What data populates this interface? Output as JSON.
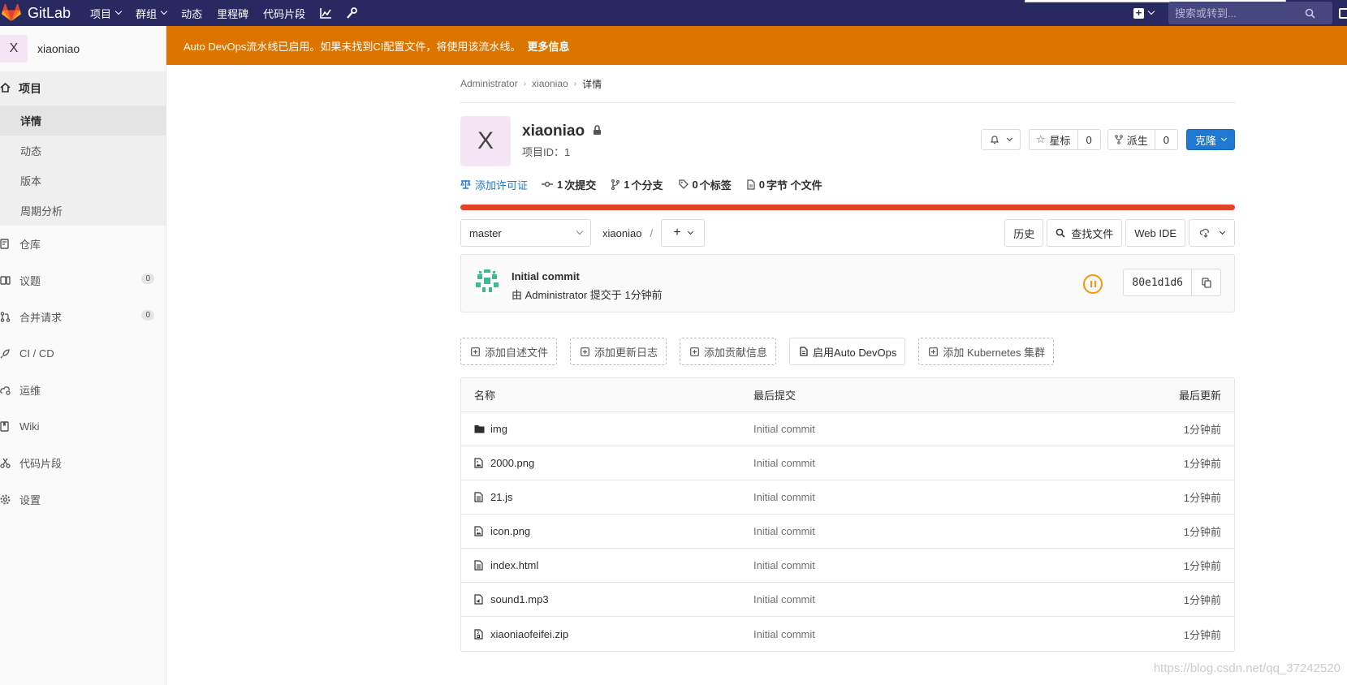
{
  "navbar": {
    "brand": "GitLab",
    "items": [
      {
        "label": "项目",
        "caret": true
      },
      {
        "label": "群组",
        "caret": true
      },
      {
        "label": "动态",
        "caret": false
      },
      {
        "label": "里程碑",
        "caret": false
      },
      {
        "label": "代码片段",
        "caret": false
      }
    ],
    "search_placeholder": "搜索或转到...",
    "colors": {
      "bg": "#292961",
      "logo": "#e24329"
    }
  },
  "sidebar": {
    "project_avatar_letter": "X",
    "project_name": "xiaoniao",
    "section_label": "项目",
    "sub_items": [
      "详情",
      "动态",
      "版本",
      "周期分析"
    ],
    "items": [
      {
        "label": "仓库",
        "icon": "repository-icon"
      },
      {
        "label": "议题",
        "icon": "issues-icon",
        "badge": "0"
      },
      {
        "label": "合并请求",
        "icon": "merge-request-icon",
        "badge": "0"
      },
      {
        "label": "CI / CD",
        "icon": "rocket-icon"
      },
      {
        "label": "运维",
        "icon": "cloud-gear-icon"
      },
      {
        "label": "Wiki",
        "icon": "book-icon"
      },
      {
        "label": "代码片段",
        "icon": "scissors-icon"
      },
      {
        "label": "设置",
        "icon": "gear-icon"
      }
    ]
  },
  "banner": {
    "text": "Auto DevOps流水线已启用。如果未找到CI配置文件，将使用该流水线。",
    "link": "更多信息",
    "color": "#db7500"
  },
  "breadcrumb": [
    "Administrator",
    "xiaoniao",
    "详情"
  ],
  "project": {
    "avatar_letter": "X",
    "name": "xiaoniao",
    "id_label": "项目ID：1",
    "star_label": "星标",
    "star_count": "0",
    "fork_label": "派生",
    "fork_count": "0",
    "clone_label": "克隆"
  },
  "stats": {
    "license": "添加许可证",
    "commits_num": "1",
    "commits_label": "次提交",
    "branches_num": "1",
    "branches_label": "个分支",
    "tags_num": "0",
    "tags_label": "个标签",
    "size_num": "0",
    "size_label": "字节 个文件"
  },
  "repo": {
    "branch": "master",
    "path": "xiaoniao",
    "path_sep": "/",
    "history": "历史",
    "find_file": "查找文件",
    "web_ide": "Web IDE"
  },
  "commit": {
    "title": "Initial commit",
    "meta": "由 Administrator 提交于 1分钟前",
    "sha": "80e1d1d6",
    "pipeline_status": "paused",
    "pipeline_color": "#fc9403"
  },
  "quick_actions": [
    {
      "label": "添加自述文件",
      "dashed": true
    },
    {
      "label": "添加更新日志",
      "dashed": true
    },
    {
      "label": "添加贡献信息",
      "dashed": true
    },
    {
      "label": "启用Auto DevOps",
      "dashed": false
    },
    {
      "label": "添加 Kubernetes 集群",
      "dashed": true
    }
  ],
  "file_tree": {
    "headers": [
      "名称",
      "最后提交",
      "最后更新"
    ],
    "rows": [
      {
        "name": "img",
        "type": "folder",
        "commit": "Initial commit",
        "updated": "1分钟前"
      },
      {
        "name": "2000.png",
        "type": "image",
        "commit": "Initial commit",
        "updated": "1分钟前"
      },
      {
        "name": "21.js",
        "type": "text",
        "commit": "Initial commit",
        "updated": "1分钟前"
      },
      {
        "name": "icon.png",
        "type": "image",
        "commit": "Initial commit",
        "updated": "1分钟前"
      },
      {
        "name": "index.html",
        "type": "text",
        "commit": "Initial commit",
        "updated": "1分钟前"
      },
      {
        "name": "sound1.mp3",
        "type": "audio",
        "commit": "Initial commit",
        "updated": "1分钟前"
      },
      {
        "name": "xiaoniaofeifei.zip",
        "type": "archive",
        "commit": "Initial commit",
        "updated": "1分钟前"
      }
    ]
  },
  "watermark": "https://blog.csdn.net/qq_37242520"
}
